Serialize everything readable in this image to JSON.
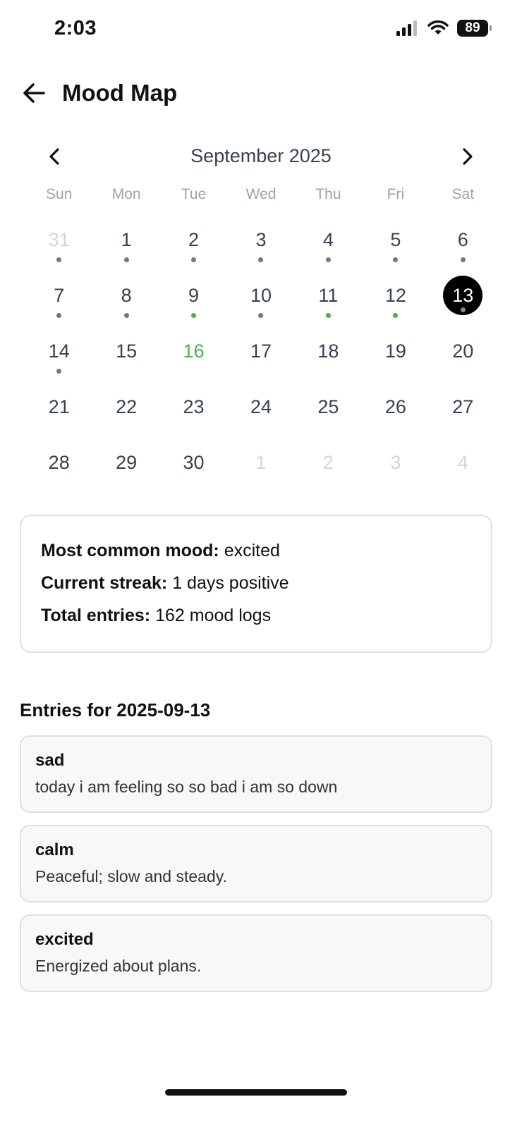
{
  "status_bar": {
    "time": "2:03",
    "battery": "89"
  },
  "header": {
    "title": "Mood Map"
  },
  "calendar": {
    "month_label": "September 2025",
    "weekdays": [
      "Sun",
      "Mon",
      "Tue",
      "Wed",
      "Thu",
      "Fri",
      "Sat"
    ],
    "days": [
      {
        "label": "31",
        "outside": true,
        "dot": "gray"
      },
      {
        "label": "1",
        "dot": "gray"
      },
      {
        "label": "2",
        "dot": "gray"
      },
      {
        "label": "3",
        "dot": "gray"
      },
      {
        "label": "4",
        "dot": "gray"
      },
      {
        "label": "5",
        "dot": "gray"
      },
      {
        "label": "6",
        "dot": "gray"
      },
      {
        "label": "7",
        "dot": "gray"
      },
      {
        "label": "8",
        "dot": "gray"
      },
      {
        "label": "9",
        "dot": "green"
      },
      {
        "label": "10",
        "dot": "gray"
      },
      {
        "label": "11",
        "dot": "green"
      },
      {
        "label": "12",
        "dot": "green"
      },
      {
        "label": "13",
        "dot": "gray",
        "selected": true
      },
      {
        "label": "14",
        "dot": "gray"
      },
      {
        "label": "15"
      },
      {
        "label": "16",
        "today": true
      },
      {
        "label": "17"
      },
      {
        "label": "18"
      },
      {
        "label": "19"
      },
      {
        "label": "20"
      },
      {
        "label": "21"
      },
      {
        "label": "22"
      },
      {
        "label": "23"
      },
      {
        "label": "24"
      },
      {
        "label": "25"
      },
      {
        "label": "26"
      },
      {
        "label": "27"
      },
      {
        "label": "28"
      },
      {
        "label": "29"
      },
      {
        "label": "30"
      },
      {
        "label": "1",
        "outside": true
      },
      {
        "label": "2",
        "outside": true
      },
      {
        "label": "3",
        "outside": true
      },
      {
        "label": "4",
        "outside": true
      }
    ]
  },
  "stats": {
    "most_common_label": "Most common mood:",
    "most_common_value": "excited",
    "streak_label": "Current streak:",
    "streak_value": "1 days positive",
    "total_label": "Total entries:",
    "total_value": "162 mood logs"
  },
  "entries": {
    "title": "Entries for 2025-09-13",
    "items": [
      {
        "mood": "sad",
        "text": "today i am feeling so so bad i am so down"
      },
      {
        "mood": "calm",
        "text": "Peaceful; slow and steady."
      },
      {
        "mood": "excited",
        "text": "Energized about plans."
      }
    ]
  },
  "colors": {
    "positive_dot": "#4caf50",
    "neutral_dot": "#777777",
    "selected_bg": "#000000"
  }
}
